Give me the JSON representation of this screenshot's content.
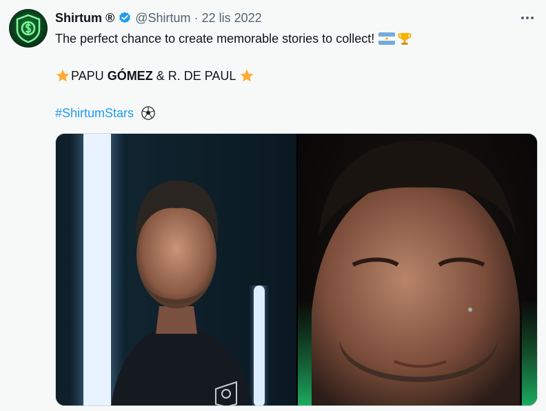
{
  "author": {
    "name": "Shirtum ®",
    "handle": "@Shirtum",
    "separator": "·",
    "date": "22 lis 2022"
  },
  "tweet": {
    "line1": "The perfect chance to create memorable stories to collect!",
    "line2_a": "PAPU ",
    "line2_b": "GÓMEZ",
    "line2_c": " & R. DE PAUL ",
    "hashtag": "#ShirtumStars"
  },
  "icons": {
    "verified": "verified-badge-icon",
    "more": "more-options-icon",
    "flag": "argentina-flag-icon",
    "trophy": "trophy-icon",
    "star": "star-icon",
    "ball": "soccer-ball-icon"
  },
  "media": {
    "photos": [
      "photo-papu-gomez",
      "photo-de-paul"
    ]
  },
  "colors": {
    "background": "#f7f9f9",
    "text": "#0f1419",
    "muted": "#536471",
    "link": "#1d9bf0",
    "verified": "#1d9bf0",
    "star": "#ffac33"
  }
}
